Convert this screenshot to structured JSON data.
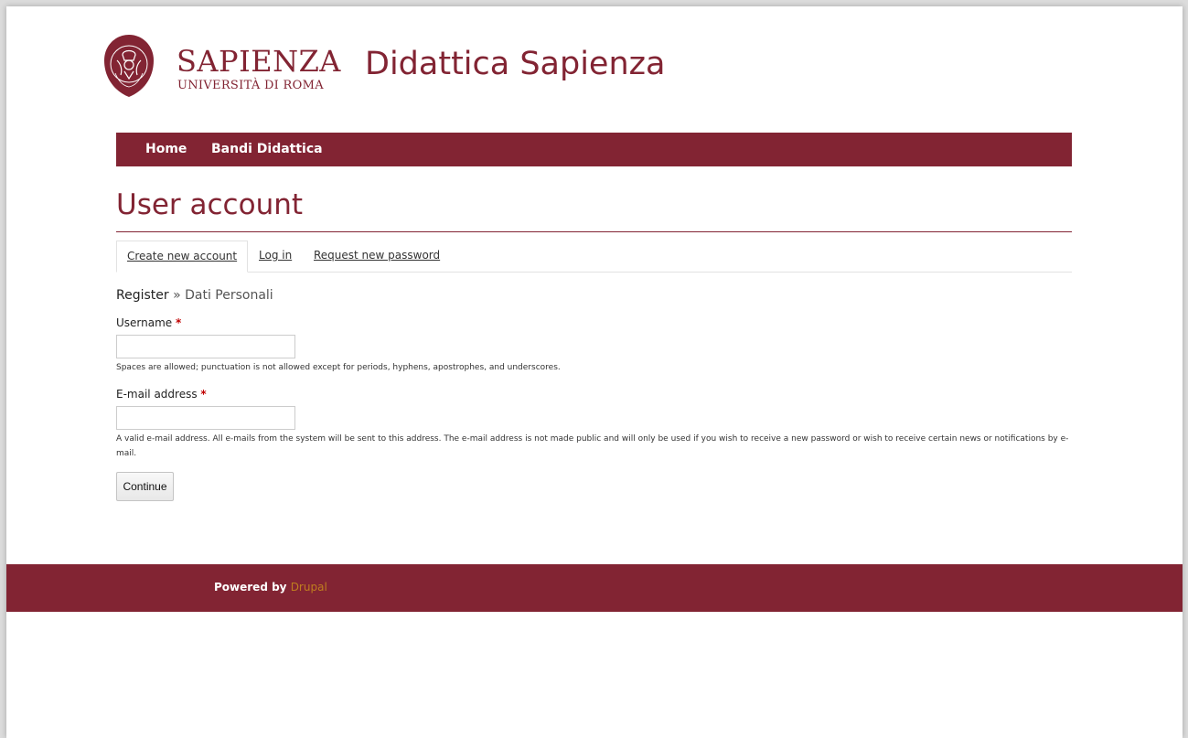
{
  "header": {
    "logo_icon": "sapienza-seal-icon",
    "logo_seal_text": "STVDIVM VRBIS",
    "brand_name": "SAPIENZA",
    "brand_subtitle": "UNIVERSITÀ DI ROMA",
    "site_title": "Didattica Sapienza"
  },
  "nav": {
    "items": [
      {
        "label": "Home"
      },
      {
        "label": "Bandi Didattica"
      }
    ]
  },
  "main": {
    "title": "User account",
    "tabs": [
      {
        "label": "Create new account",
        "active": true
      },
      {
        "label": "Log in",
        "active": false
      },
      {
        "label": "Request new password",
        "active": false
      }
    ],
    "step": {
      "current": "Register",
      "separator": " » ",
      "next": "Dati Personali"
    },
    "form": {
      "username": {
        "label": "Username",
        "required_marker": "*",
        "value": "",
        "help": "Spaces are allowed; punctuation is not allowed except for periods, hyphens, apostrophes, and underscores."
      },
      "email": {
        "label": "E-mail address",
        "required_marker": "*",
        "value": "",
        "help": "A valid e-mail address. All e-mails from the system will be sent to this address. The e-mail address is not made public and will only be used if you wish to receive a new password or wish to receive certain news or notifications by e-mail."
      },
      "submit_label": "Continue"
    }
  },
  "footer": {
    "powered_by": "Powered by",
    "link_label": "Drupal"
  },
  "colors": {
    "brand": "#822433",
    "link_footer": "#f1c40f",
    "required": "#c00000"
  }
}
